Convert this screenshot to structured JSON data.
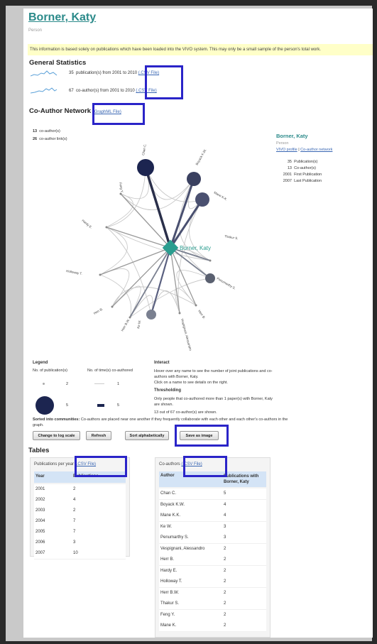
{
  "person": {
    "name": "Borner, Katy",
    "type": "Person",
    "notice": "This information is based solely on publications which have been loaded into the VIVO system. This may only be a small sample of the person's total work."
  },
  "general_statistics": {
    "title": "General Statistics",
    "pub_count": "35",
    "pub_text": "publication(s) from 2001 to 2010",
    "coauthor_count": "67",
    "coauthor_text": "co-author(s) from 2001 to 2010",
    "csv_link": "(.CSV File)"
  },
  "coauthor_network": {
    "title": "Co-Author Network",
    "graphml_link": "(GraphML File)",
    "summary_coauthors": "13",
    "summary_coauthors_label": "co-author(s)",
    "summary_links": "26",
    "summary_links_label": "co-author link(s)",
    "ego_label": "Borner, Katy",
    "nodes": [
      "Chan C.",
      "Boyack K.W.",
      "Mane K.K.",
      "Thakur S.",
      "Penumarthy S.",
      "Ke W.",
      "Vespignani, Alessandro",
      "Herr B.W.",
      "Ke W.",
      "Herr B.",
      "Holloway T.",
      "Hardy E.",
      "Feng Y."
    ]
  },
  "sidebar": {
    "name": "Borner, Katy",
    "type": "Person",
    "vivo_profile": "VIVO profile",
    "separator": "|",
    "coauthor_network": "Co-author network",
    "stats": [
      {
        "value": "35",
        "label": "Publication(s)"
      },
      {
        "value": "13",
        "label": "Co-author(s)"
      },
      {
        "value": "2001",
        "label": "First Publication"
      },
      {
        "value": "2007",
        "label": "Last Publication"
      }
    ]
  },
  "legend": {
    "title": "Legend",
    "pubs_label": "No. of publication(s)",
    "coauth_label": "No. of time(s) co-authored",
    "small_pub": "2",
    "large_pub": "5",
    "thin_line": "1",
    "thick_line": "5"
  },
  "interact": {
    "title": "Interact",
    "text1": "Hover over any name to see the number of joint publications and co-authors with Borner, Katy.",
    "text2": "Click on a name to see details on the right.",
    "threshold_title": "Thresholding",
    "threshold_text": "Only people that co-authored more than 1 paper(s) with Borner, Katy are shown.",
    "threshold_count": "13 out of 67 co-author(s) are shown."
  },
  "communities": {
    "label": "Sorted into communities:",
    "text": "Co-authors are placed near one another if they frequently collaborate with each other and each other's co-authors in the graph."
  },
  "buttons": {
    "log_scale": "Change to log scale",
    "refresh": "Refresh",
    "sort": "Sort alphabetically",
    "save": "Save as image"
  },
  "tables": {
    "title": "Tables",
    "pubs": {
      "caption": "Publications per year",
      "csv": "(.CSV File)",
      "col_year": "Year",
      "col_pubs": "Publications",
      "rows": [
        {
          "year": "2001",
          "count": "2"
        },
        {
          "year": "2002",
          "count": "4"
        },
        {
          "year": "2003",
          "count": "2"
        },
        {
          "year": "2004",
          "count": "7"
        },
        {
          "year": "2005",
          "count": "7"
        },
        {
          "year": "2006",
          "count": "3"
        },
        {
          "year": "2007",
          "count": "10"
        }
      ]
    },
    "coauthors": {
      "caption": "Co-authors",
      "csv": "(.CSV File)",
      "col_author": "Author",
      "col_pubs": "Publications with Borner, Katy",
      "rows": [
        {
          "author": "Chan C.",
          "count": "5"
        },
        {
          "author": "Boyack K.W.",
          "count": "4"
        },
        {
          "author": "Mane K.K.",
          "count": "4"
        },
        {
          "author": "Ke W.",
          "count": "3"
        },
        {
          "author": "Penumarthy S.",
          "count": "3"
        },
        {
          "author": "Vespignani, Alessandro",
          "count": "2"
        },
        {
          "author": "Herr B.",
          "count": "2"
        },
        {
          "author": "Hardy E.",
          "count": "2"
        },
        {
          "author": "Holloway T.",
          "count": "2"
        },
        {
          "author": "Herr B.W.",
          "count": "2"
        },
        {
          "author": "Thakur S.",
          "count": "2"
        },
        {
          "author": "Feng Y.",
          "count": "2"
        },
        {
          "author": "Mane K.",
          "count": "2"
        }
      ]
    }
  },
  "colors": {
    "accent": "#2b8a8a",
    "link": "#3a67b3",
    "highlight_box": "#2a24c8",
    "node_dark": "#1c2550",
    "ego": "#2a9d8f"
  }
}
